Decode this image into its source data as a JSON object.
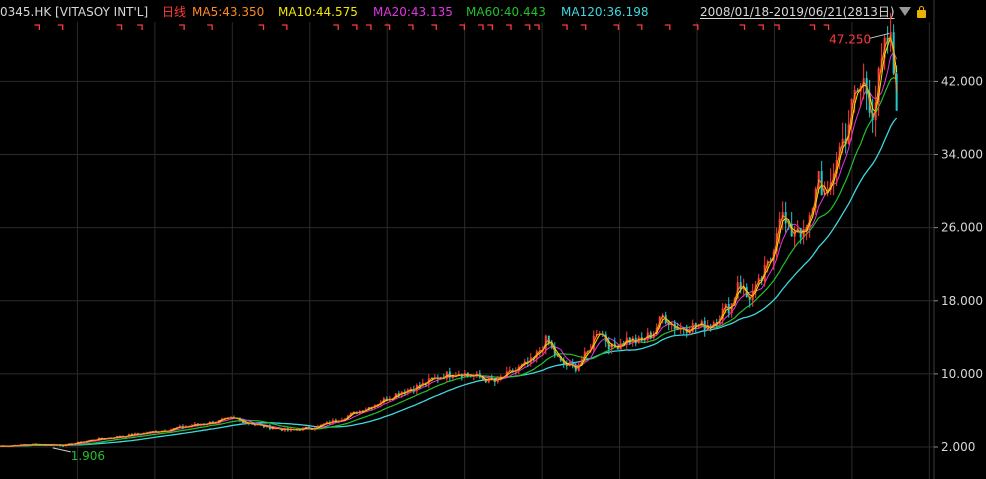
{
  "header": {
    "symbol": "0345.HK [VITASOY INT'L]",
    "period": "日线",
    "range": "2008/01/18-2019/06/21(2813日)"
  },
  "colors": {
    "background": "#000000",
    "grid": "#2a2a2a",
    "up": "#ff3b3b",
    "down": "#22c9c9",
    "ma5": "#ff8a1f",
    "ma10": "#f2e600",
    "ma20": "#e236e2",
    "ma60": "#22c02a",
    "ma120": "#3fd8df",
    "axis_text": "#d8d8d8",
    "marker": "#ff3b3b"
  },
  "chart_data": {
    "type": "line",
    "title": "0345.HK [VITASOY INT'L]",
    "xlabel": "",
    "ylabel": "",
    "x_range": [
      "2008/01/18",
      "2019/06/21"
    ],
    "ylim": [
      -1.5,
      48.5
    ],
    "y_ticks": [
      2.0,
      10.0,
      18.0,
      26.0,
      34.0,
      42.0
    ],
    "y_tick_labels": [
      "2.000",
      "10.000",
      "18.000",
      "26.000",
      "34.000",
      "42.000"
    ],
    "grid": true,
    "x_grid_count": 12,
    "series": [
      {
        "name": "MA5",
        "label": "MA5:43.350",
        "last": 43.35
      },
      {
        "name": "MA10",
        "label": "MA10:44.575",
        "last": 44.575
      },
      {
        "name": "MA20",
        "label": "MA20:43.135",
        "last": 43.135
      },
      {
        "name": "MA60",
        "label": "MA60:40.443",
        "last": 40.443
      },
      {
        "name": "MA120",
        "label": "MA120:36.198",
        "last": 36.198
      }
    ],
    "price_shape": [
      [
        0.0,
        2.1
      ],
      [
        0.04,
        2.3
      ],
      [
        0.07,
        2.2
      ],
      [
        0.1,
        2.8
      ],
      [
        0.14,
        3.3
      ],
      [
        0.18,
        3.9
      ],
      [
        0.22,
        4.6
      ],
      [
        0.25,
        5.1
      ],
      [
        0.28,
        4.3
      ],
      [
        0.31,
        3.8
      ],
      [
        0.34,
        4.2
      ],
      [
        0.37,
        5.3
      ],
      [
        0.4,
        6.6
      ],
      [
        0.43,
        8.1
      ],
      [
        0.45,
        8.7
      ],
      [
        0.47,
        9.7
      ],
      [
        0.49,
        10.2
      ],
      [
        0.51,
        9.7
      ],
      [
        0.53,
        9.1
      ],
      [
        0.55,
        10.3
      ],
      [
        0.57,
        11.4
      ],
      [
        0.585,
        13.7
      ],
      [
        0.6,
        11.2
      ],
      [
        0.615,
        10.6
      ],
      [
        0.63,
        12.4
      ],
      [
        0.64,
        15.1
      ],
      [
        0.655,
        12.8
      ],
      [
        0.67,
        13.8
      ],
      [
        0.685,
        13.5
      ],
      [
        0.7,
        14.6
      ],
      [
        0.71,
        16.4
      ],
      [
        0.725,
        15.0
      ],
      [
        0.74,
        15.2
      ],
      [
        0.76,
        15.3
      ],
      [
        0.77,
        16.5
      ],
      [
        0.785,
        17.8
      ],
      [
        0.79,
        20.4
      ],
      [
        0.8,
        18.3
      ],
      [
        0.81,
        19.2
      ],
      [
        0.825,
        22.4
      ],
      [
        0.835,
        28.0
      ],
      [
        0.845,
        25.2
      ],
      [
        0.855,
        26.5
      ],
      [
        0.86,
        24.8
      ],
      [
        0.87,
        27.5
      ],
      [
        0.875,
        32.6
      ],
      [
        0.885,
        28.3
      ],
      [
        0.895,
        33.7
      ],
      [
        0.905,
        36.2
      ],
      [
        0.915,
        40.2
      ],
      [
        0.925,
        42.0
      ],
      [
        0.935,
        38.8
      ],
      [
        0.945,
        44.1
      ],
      [
        0.952,
        47.25
      ],
      [
        0.96,
        40.3
      ]
    ],
    "annotations": [
      {
        "label": "47.250",
        "kind": "high",
        "x": 0.952,
        "y": 47.25
      },
      {
        "label": "1.906",
        "kind": "low",
        "x": 0.065,
        "y": 1.906
      }
    ],
    "event_markers_x": [
      0.04,
      0.065,
      0.128,
      0.15,
      0.195,
      0.225,
      0.28,
      0.305,
      0.36,
      0.38,
      0.395,
      0.415,
      0.44,
      0.465,
      0.495,
      0.515,
      0.525,
      0.545,
      0.565,
      0.575,
      0.605,
      0.625,
      0.66,
      0.685,
      0.715,
      0.745,
      0.795,
      0.815,
      0.832,
      0.87,
      0.885
    ]
  }
}
